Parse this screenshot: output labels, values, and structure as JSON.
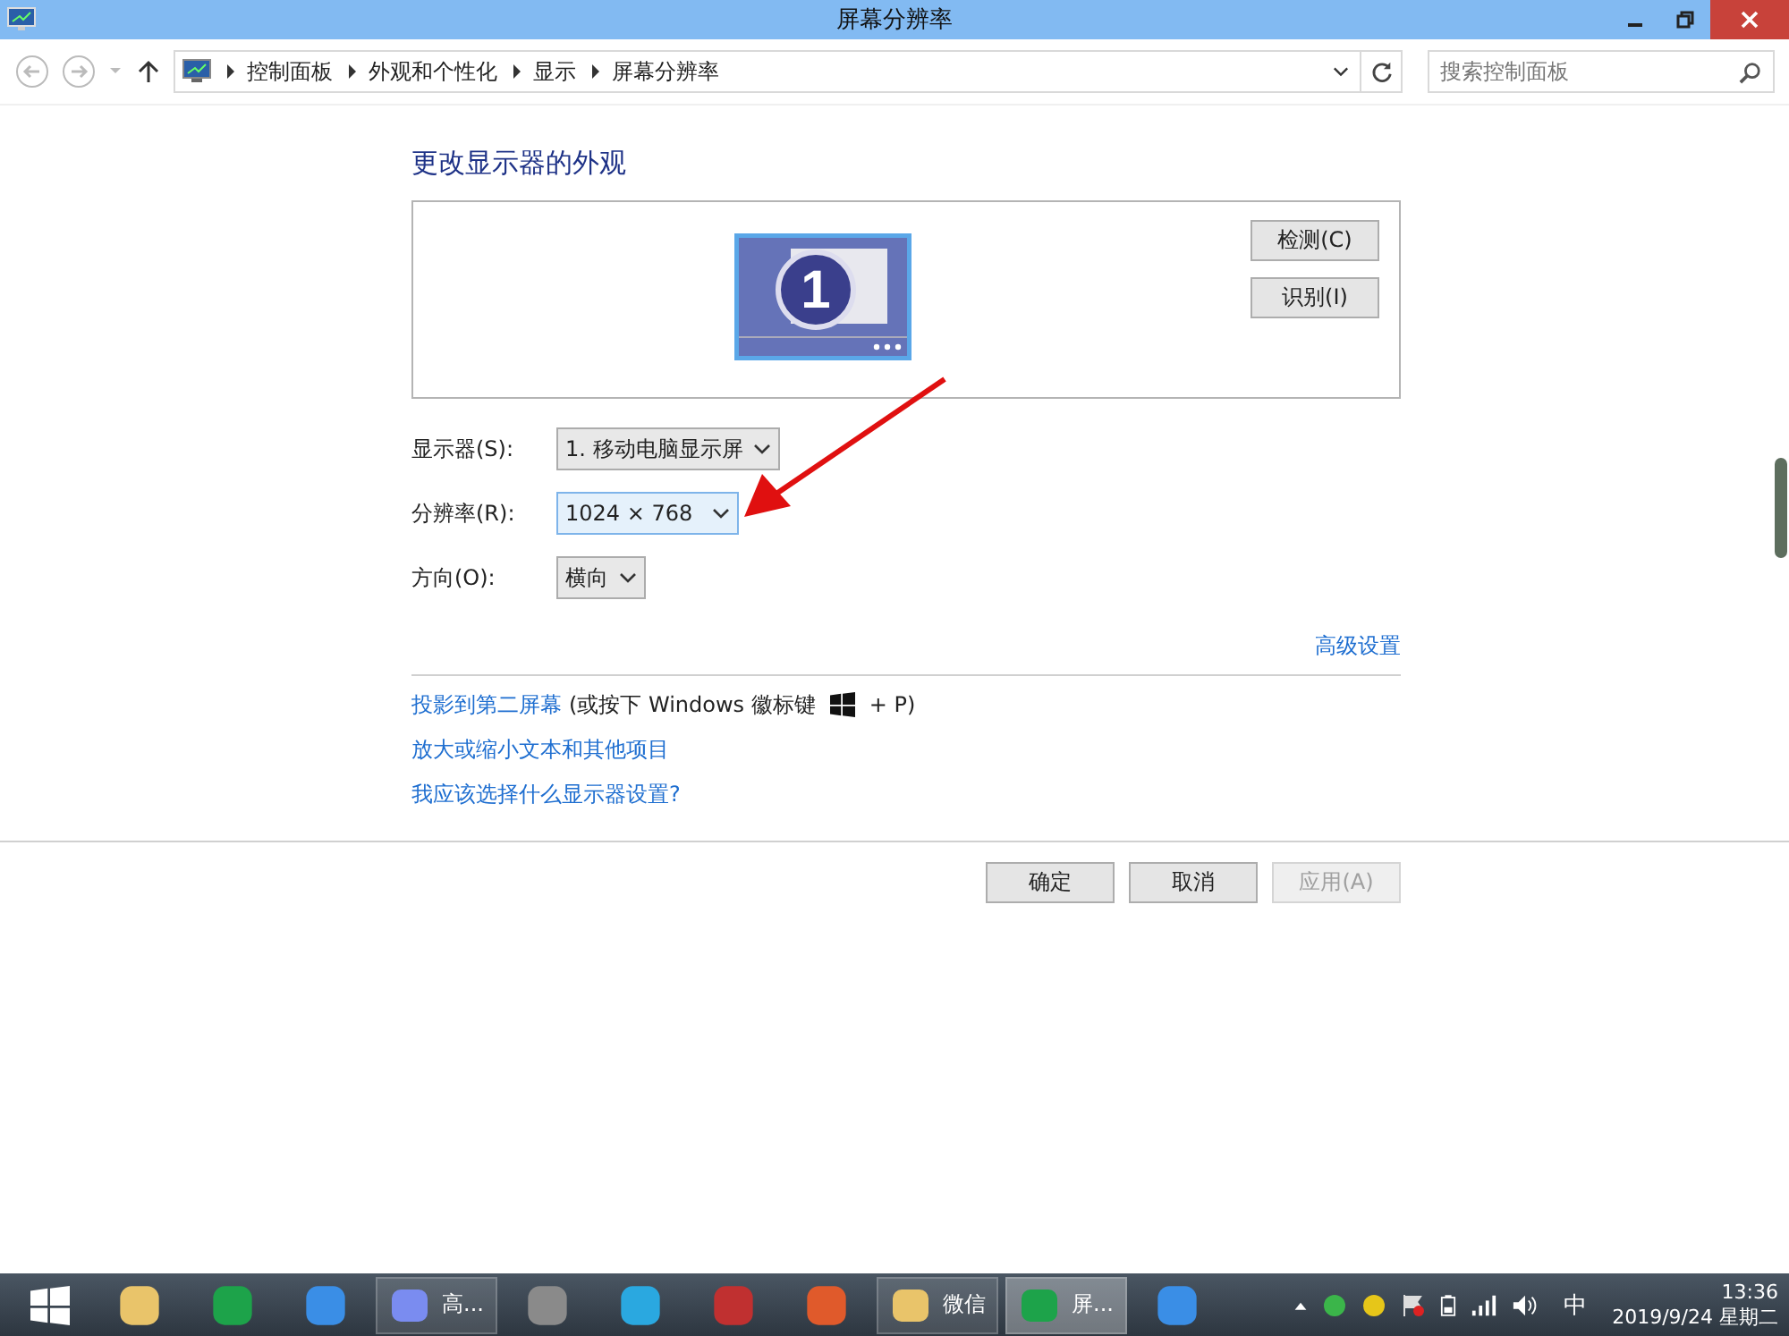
{
  "window": {
    "title": "屏幕分辨率"
  },
  "address_bar": {
    "breadcrumbs": [
      "控制面板",
      "外观和个性化",
      "显示",
      "屏幕分辨率"
    ],
    "search": {
      "placeholder": "搜索控制面板"
    }
  },
  "content": {
    "heading": "更改显示器的外观",
    "preview": {
      "monitor_number": "1",
      "buttons": [
        "检测(C)",
        "识别(I)"
      ]
    },
    "fields": [
      {
        "label": "显示器(S):",
        "value": "1. 移动电脑显示屏",
        "focused": false
      },
      {
        "label": "分辨率(R):",
        "value": "1024 × 768",
        "focused": true
      },
      {
        "label": "方向(O):",
        "value": "横向",
        "focused": false
      }
    ],
    "advanced_link": "高级设置",
    "links": [
      {
        "text": "投影到第二屏幕",
        "note_before": "(或按下 Windows 徽标键",
        "note_after": "+ P)"
      },
      {
        "text": "放大或缩小文本和其他项目"
      },
      {
        "text": "我应该选择什么显示器设置?"
      }
    ],
    "buttons": [
      {
        "label": "确定",
        "disabled": false
      },
      {
        "label": "取消",
        "disabled": false
      },
      {
        "label": "应用(A)",
        "disabled": true
      }
    ]
  },
  "taskbar": {
    "items": [
      {
        "kind": "start"
      },
      {
        "kind": "icon"
      },
      {
        "kind": "icon"
      },
      {
        "kind": "icon"
      },
      {
        "kind": "app",
        "label": "高...",
        "selected": false
      },
      {
        "kind": "icon"
      },
      {
        "kind": "icon"
      },
      {
        "kind": "icon"
      },
      {
        "kind": "icon"
      },
      {
        "kind": "app",
        "label": "微信",
        "selected": false
      },
      {
        "kind": "app",
        "label": "屏...",
        "selected": true
      },
      {
        "kind": "icon"
      }
    ],
    "input_method": "中",
    "time": "13:36",
    "date": "2019/9/24 星期二"
  }
}
